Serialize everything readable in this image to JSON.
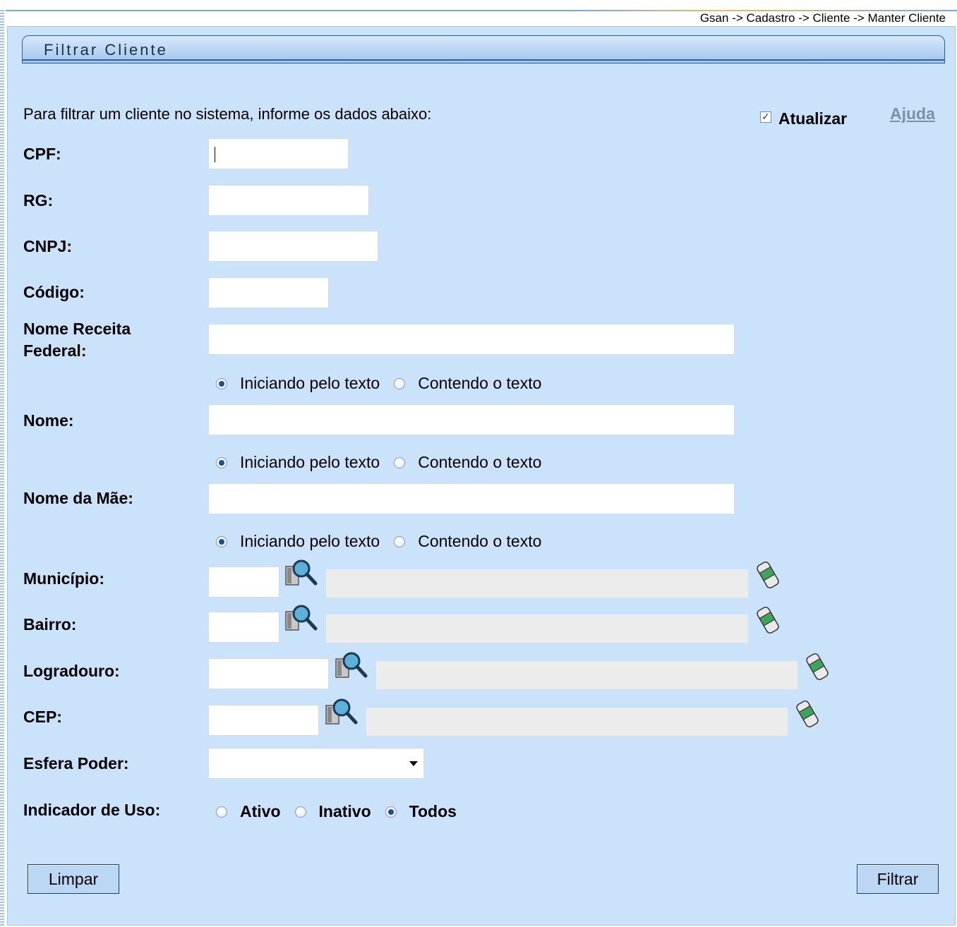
{
  "breadcrumb": "Gsan -> Cadastro -> Cliente -> Manter Cliente",
  "header": {
    "title": "Filtrar Cliente"
  },
  "intro": "Para filtrar um cliente no sistema, informe os dados abaixo:",
  "atualizar": {
    "label": "Atualizar",
    "checked": true
  },
  "ajuda": "Ajuda",
  "fields": {
    "cpf": {
      "label": "CPF:",
      "value": ""
    },
    "rg": {
      "label": "RG:",
      "value": ""
    },
    "cnpj": {
      "label": "CNPJ:",
      "value": ""
    },
    "codigo": {
      "label": "Código:",
      "value": ""
    },
    "nome_receita": {
      "label_line1": "Nome Receita",
      "label_line2": "Federal:",
      "value": ""
    },
    "nome": {
      "label": "Nome:",
      "value": ""
    },
    "nome_mae": {
      "label": "Nome da Mãe:",
      "value": ""
    },
    "municipio": {
      "label": "Município:",
      "value": ""
    },
    "bairro": {
      "label": "Bairro:",
      "value": ""
    },
    "logradouro": {
      "label": "Logradouro:",
      "value": ""
    },
    "cep": {
      "label": "CEP:",
      "value": ""
    },
    "esfera_poder": {
      "label": "Esfera Poder:",
      "selected": ""
    }
  },
  "match_options": {
    "starts": "Iniciando pelo texto",
    "contains": "Contendo o texto",
    "selected": "starts"
  },
  "indicador_uso": {
    "label": "Indicador de Uso:",
    "options": [
      "Ativo",
      "Inativo",
      "Todos"
    ],
    "selected": "Todos"
  },
  "buttons": {
    "limpar": "Limpar",
    "filtrar": "Filtrar"
  },
  "icons": {
    "lookup": "magnifier-lookup-icon",
    "clear": "eraser-icon"
  },
  "colors": {
    "panel_bg": "#cbe3fa",
    "header_border": "#2c5ea0",
    "button_bg": "#bcd7f4"
  }
}
